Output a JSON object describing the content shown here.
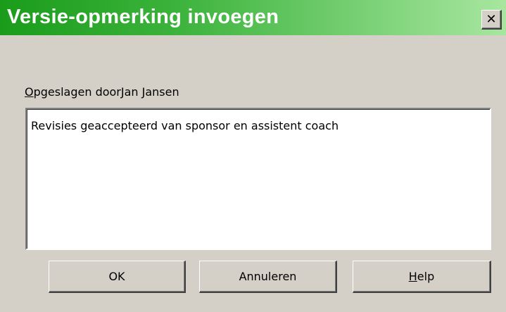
{
  "window": {
    "title": "Versie-opmerking invoegen",
    "close_symbol": "✕",
    "close_icon": "close-icon"
  },
  "form": {
    "saved_by_label_mnemonic": "O",
    "saved_by_label_rest": "pgeslagen door",
    "saved_by_name": "Jan Jansen",
    "comment_value": "Revisies geaccepteerd van sponsor en assistent coach"
  },
  "buttons": {
    "ok_label": "OK",
    "cancel_label": "Annuleren",
    "help_mnemonic": "H",
    "help_rest": "elp"
  },
  "colors": {
    "titlebar_start": "#1a9c1a",
    "titlebar_end": "#a8e6a0",
    "dialog_background": "#d4d0c8",
    "title_text": "#ffffff"
  }
}
